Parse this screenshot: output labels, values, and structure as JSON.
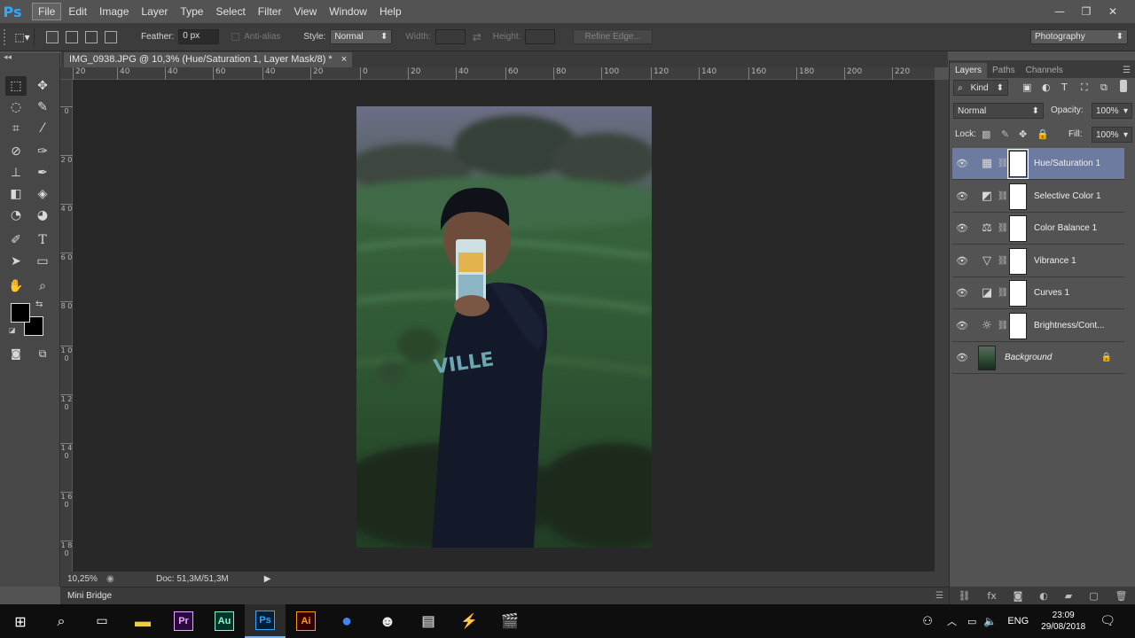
{
  "app": {
    "logo": "Ps"
  },
  "menu": [
    "File",
    "Edit",
    "Image",
    "Layer",
    "Type",
    "Select",
    "Filter",
    "View",
    "Window",
    "Help"
  ],
  "window_controls": {
    "minimize": "—",
    "restore": "❐",
    "close": "✕"
  },
  "options": {
    "feather_label": "Feather:",
    "feather_value": "0 px",
    "antialias_label": "Anti-alias",
    "style_label": "Style:",
    "style_value": "Normal",
    "width_label": "Width:",
    "height_label": "Height:",
    "refine_edge": "Refine Edge...",
    "workspace": "Photography"
  },
  "document": {
    "tab_title": "IMG_0938.JPG @ 10,3% (Hue/Saturation 1, Layer Mask/8) *",
    "close": "×",
    "zoom": "10,25%",
    "doc_info": "Doc: 51,3M/51,3M",
    "shirt_text": "VILLE"
  },
  "ruler": {
    "h_labels": [
      "20",
      "0",
      "20",
      "40",
      "60",
      "80",
      "100",
      "120",
      "140",
      "160",
      "180",
      "200",
      "220"
    ],
    "h_left_labels": [
      "20",
      "40",
      "60",
      "20"
    ],
    "v_labels": [
      "0",
      "2 0",
      "4 0",
      "6 0",
      "8 0",
      "1 0 0",
      "1 2 0",
      "1 4 0",
      "1 6 0",
      "1 8 0"
    ]
  },
  "layers_panel": {
    "tabs": [
      "Layers",
      "Paths",
      "Channels"
    ],
    "active_tab": "Layers",
    "filter_kind": "Kind",
    "blend_mode": "Normal",
    "opacity_label": "Opacity:",
    "opacity_value": "100%",
    "lock_label": "Lock:",
    "fill_label": "Fill:",
    "fill_value": "100%",
    "layers": [
      {
        "name": "Hue/Saturation 1",
        "icon": "hue-saturation-icon",
        "glyph": "▦",
        "selected": true
      },
      {
        "name": "Selective Color 1",
        "icon": "selective-color-icon",
        "glyph": "◩",
        "selected": false
      },
      {
        "name": "Color Balance 1",
        "icon": "color-balance-icon",
        "glyph": "⚖",
        "selected": false
      },
      {
        "name": "Vibrance 1",
        "icon": "vibrance-icon",
        "glyph": "▽",
        "selected": false
      },
      {
        "name": "Curves 1",
        "icon": "curves-icon",
        "glyph": "◪",
        "selected": false
      },
      {
        "name": "Brightness/Cont...",
        "icon": "brightness-contrast-icon",
        "glyph": "☼",
        "selected": false
      }
    ],
    "background_layer": "Background"
  },
  "bottom": {
    "mini_bridge": "Mini Bridge"
  },
  "taskbar": {
    "time": "23:09",
    "date": "29/08/2018",
    "lang": "ENG",
    "apps": [
      {
        "id": "file-explorer-icon",
        "glyph": "▬",
        "color": "#f2c94c",
        "bg": "transparent"
      },
      {
        "id": "premiere-icon",
        "glyph": "Pr",
        "color": "#e9a8ff",
        "bg": "#2b0a3d"
      },
      {
        "id": "audition-icon",
        "glyph": "Au",
        "color": "#8ff2c8",
        "bg": "#00342b"
      },
      {
        "id": "photoshop-icon",
        "glyph": "Ps",
        "color": "#31a8ff",
        "bg": "#001e36"
      },
      {
        "id": "illustrator-icon",
        "glyph": "Ai",
        "color": "#ff9a00",
        "bg": "#330000"
      },
      {
        "id": "chrome-icon",
        "glyph": "●",
        "color": "#4285f4",
        "bg": "transparent"
      },
      {
        "id": "app-mascot-icon",
        "glyph": "☻",
        "color": "#e8e8e8",
        "bg": "transparent"
      },
      {
        "id": "app-dark-icon",
        "glyph": "▤",
        "color": "#bbbbbb",
        "bg": "transparent"
      },
      {
        "id": "app-lightning-icon",
        "glyph": "⚡",
        "color": "#e6c071",
        "bg": "transparent"
      },
      {
        "id": "movie-maker-icon",
        "glyph": "🎬",
        "color": "#ffffff",
        "bg": "transparent"
      }
    ]
  }
}
